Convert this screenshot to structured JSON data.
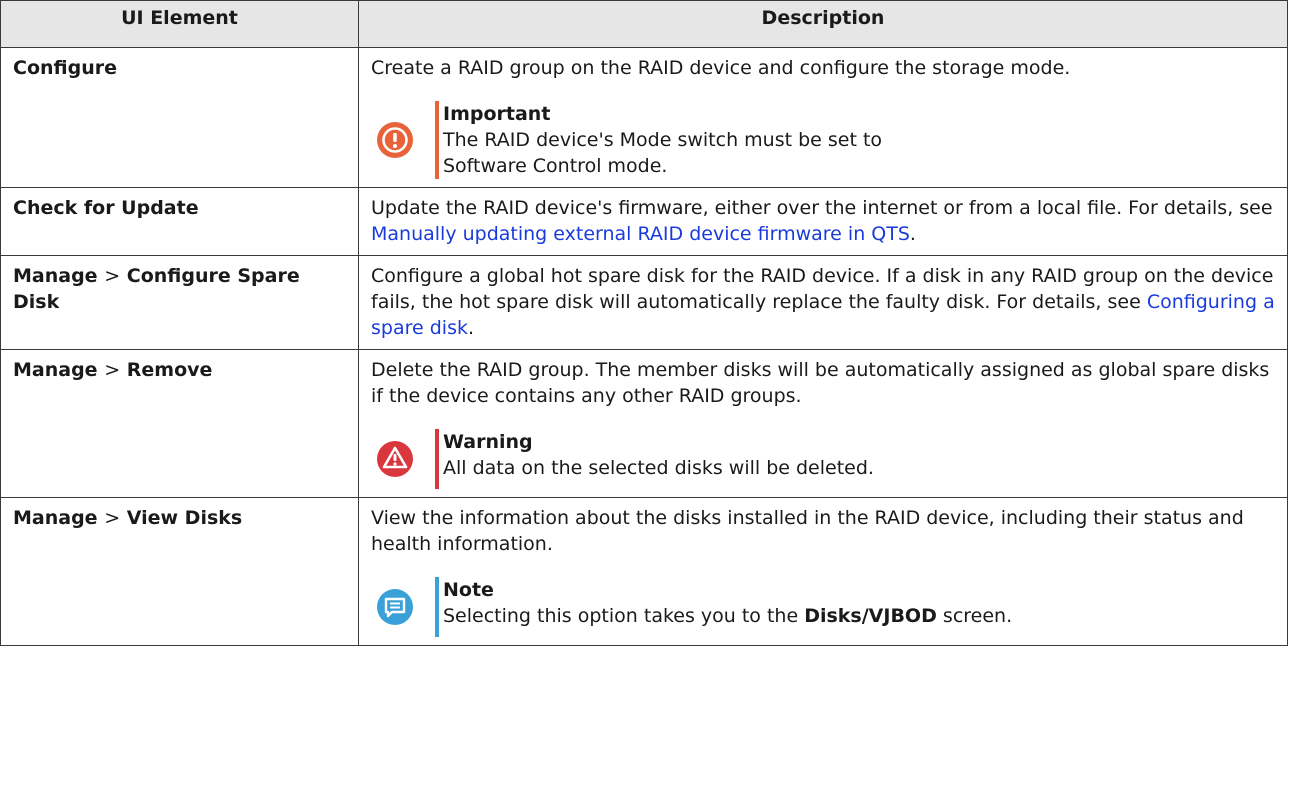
{
  "header": {
    "col1": "UI Element",
    "col2": "Description"
  },
  "rows": [
    {
      "element": "Configure",
      "description": "Create a RAID group on the RAID device and configure the storage mode.",
      "callout": {
        "type": "important",
        "title": "Important",
        "text": "The RAID device's Mode switch must be set to Software Control mode."
      }
    },
    {
      "element": "Check for Update",
      "description_pre": "Update the RAID device's firmware, either over the internet or from a local file. For details, see ",
      "link": "Manually updating external RAID device firmware in QTS",
      "description_post": "."
    },
    {
      "element_a": "Manage",
      "separator": ">",
      "element_b": "Configure Spare Disk",
      "description_pre": "Configure a global hot spare disk for the RAID device. If a disk in any RAID group on the device fails, the hot spare disk will automatically replace the faulty disk. For details, see ",
      "link": "Configuring a spare disk",
      "description_post": "."
    },
    {
      "element_a": "Manage",
      "separator": ">",
      "element_b": "Remove",
      "description": "Delete the RAID group. The member disks will be automatically assigned as global spare disks if the device contains any other RAID groups.",
      "callout": {
        "type": "warning",
        "title": "Warning",
        "text": "All data on the selected disks will be deleted."
      }
    },
    {
      "element_a": "Manage",
      "separator": ">",
      "element_b": "View Disks",
      "description": "View the information about the disks installed in the RAID device, including their status and health information.",
      "callout": {
        "type": "note",
        "title": "Note",
        "text_pre": "Selecting this option takes you to the ",
        "text_bold": "Disks/VJBOD",
        "text_post": " screen."
      }
    }
  ],
  "colors": {
    "important": "#e8623a",
    "warning": "#d9363e",
    "note": "#3aa0d8",
    "link": "#1a3bdc",
    "header_bg": "#e6e6e6"
  },
  "icons": {
    "important": "exclamation-circle-icon",
    "warning": "warning-triangle-icon",
    "note": "note-speech-icon"
  }
}
